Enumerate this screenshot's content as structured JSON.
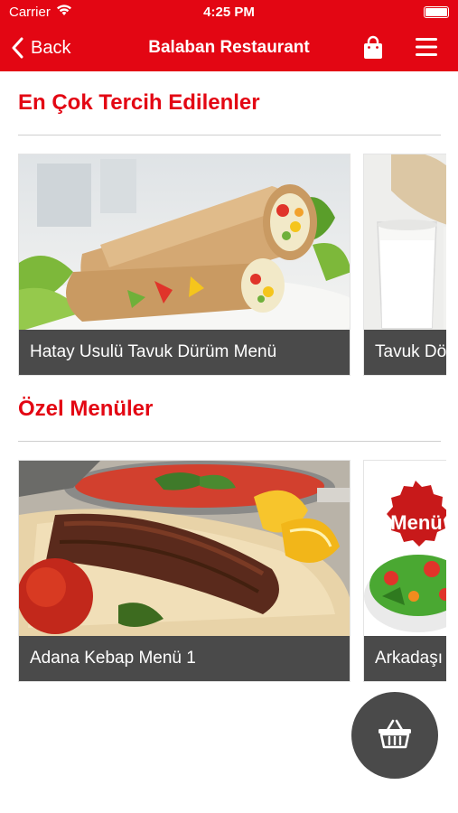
{
  "status_bar": {
    "carrier": "Carrier",
    "time": "4:25 PM"
  },
  "nav": {
    "back_label": "Back",
    "title": "Balaban Restaurant"
  },
  "sections": [
    {
      "title": "En Çok Tercih Edilenler",
      "items": [
        {
          "name": "Hatay Usulü Tavuk Dürüm Menü"
        },
        {
          "name": "Tavuk Dö"
        }
      ]
    },
    {
      "title": "Özel Menüler",
      "items": [
        {
          "name": "Adana Kebap Menü 1"
        },
        {
          "name": "Arkadaşı",
          "badge": "Menü"
        }
      ]
    }
  ],
  "colors": {
    "brand": "#e30613",
    "caption_bg": "#4a4a4a",
    "divider": "#cfcfcf"
  },
  "icons": {
    "back": "chevron-left-icon",
    "bag": "shopping-bag-icon",
    "menu": "hamburger-menu-icon",
    "basket": "basket-icon"
  }
}
